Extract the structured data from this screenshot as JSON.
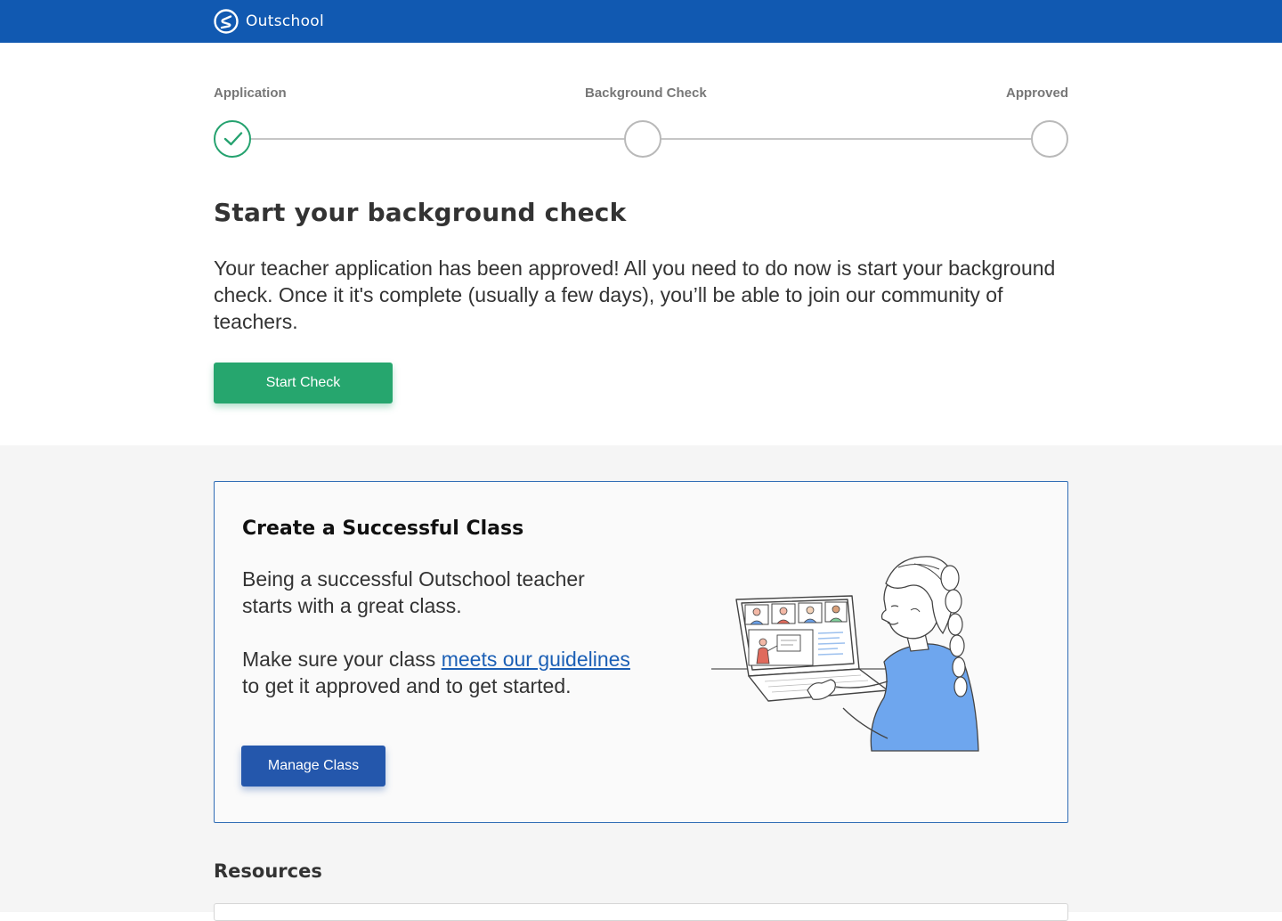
{
  "header": {
    "brand_name": "Outschool",
    "logo_icon": "outschool-logo-icon",
    "background_color": "#1159b1"
  },
  "stepper": {
    "steps": [
      {
        "label": "Application",
        "state": "complete"
      },
      {
        "label": "Background Check",
        "state": "incomplete"
      },
      {
        "label": "Approved",
        "state": "incomplete"
      }
    ],
    "complete_color": "#25a26f",
    "current_step": 1
  },
  "hero": {
    "title": "Start your background check",
    "body": "Your teacher application has been approved! All you need to do now is start your background check. Once it it's complete (usually a few days), you’ll be able to join our community of teachers.",
    "button_label": "Start Check",
    "button_color": "#26a66e"
  },
  "card": {
    "title": "Create a Successful Class",
    "paragraph_1": "Being a successful Outschool teacher starts with a great class.",
    "paragraph_2_before": "Make sure your class ",
    "paragraph_2_link": "meets our guidelines",
    "paragraph_2_after": " to get it approved and to get started.",
    "button_label": "Manage Class",
    "button_color": "#2457ac",
    "border_color": "#2f6cb5",
    "illustration": "teacher-with-laptop-video-class-illustration"
  },
  "resources": {
    "title": "Resources"
  }
}
